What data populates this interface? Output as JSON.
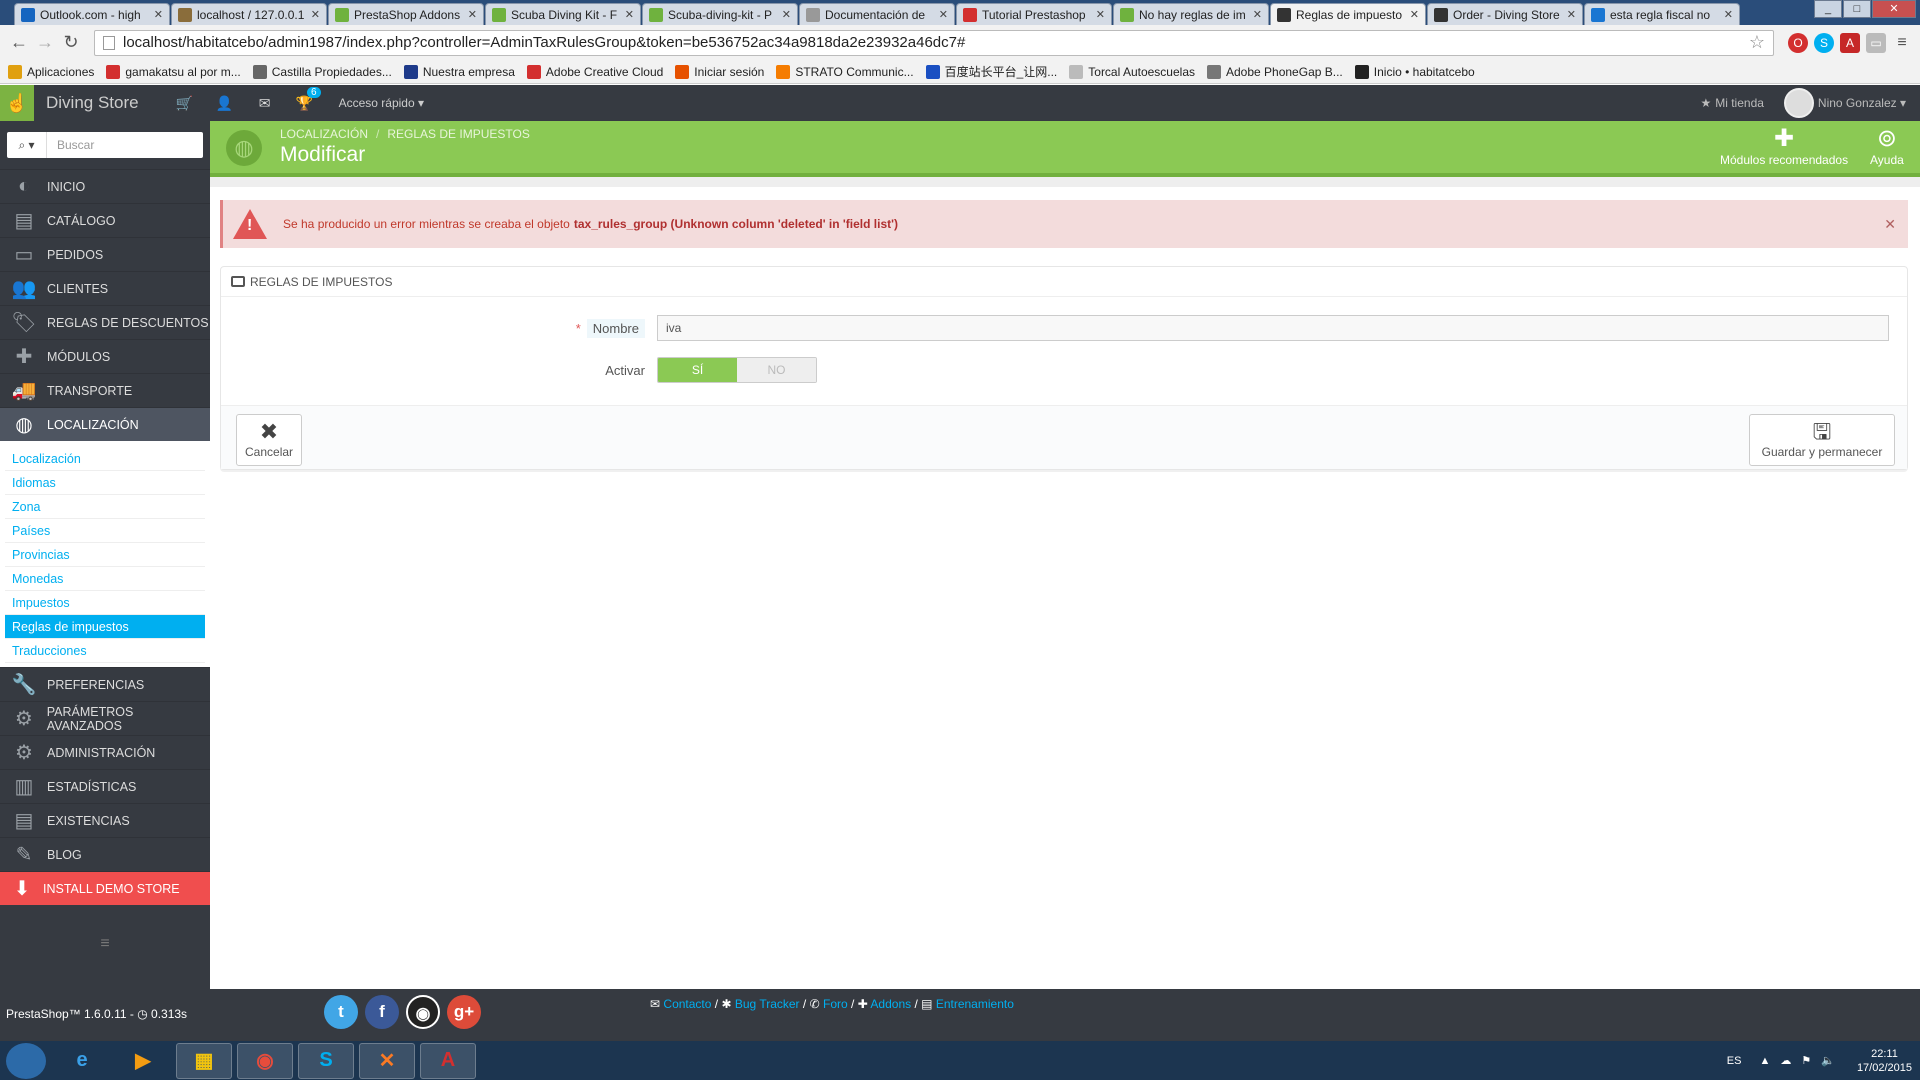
{
  "browser": {
    "tabs": [
      {
        "label": "Outlook.com - high",
        "color": "#1565c0"
      },
      {
        "label": "localhost / 127.0.0.1",
        "color": "#8a6d3b"
      },
      {
        "label": "PrestaShop Addons",
        "color": "#6fb23e"
      },
      {
        "label": "Scuba Diving Kit - F",
        "color": "#6fb23e"
      },
      {
        "label": "Scuba-diving-kit - P",
        "color": "#6fb23e"
      },
      {
        "label": "Documentación de",
        "color": "#999999"
      },
      {
        "label": "Tutorial Prestashop",
        "color": "#d32f2f"
      },
      {
        "label": "No hay reglas de im",
        "color": "#6fb23e"
      },
      {
        "label": "Reglas de impuesto",
        "color": "#333333"
      },
      {
        "label": "Order - Diving Store",
        "color": "#333333"
      },
      {
        "label": "esta regla fiscal no",
        "color": "#1976d2"
      }
    ],
    "active_tab_index": 8,
    "url": "localhost/habitatcebo/admin1987/index.php?controller=AdminTaxRulesGroup&token=be536752ac34a9818da2e23932a46dc7#",
    "bookmarks": [
      {
        "label": "Aplicaciones",
        "color": "#e0a010"
      },
      {
        "label": "gamakatsu al por m...",
        "color": "#d32f2f"
      },
      {
        "label": "Castilla Propiedades...",
        "color": "#666666"
      },
      {
        "label": "Nuestra empresa",
        "color": "#1e3a8a"
      },
      {
        "label": "Adobe Creative Cloud",
        "color": "#d32f2f"
      },
      {
        "label": "Iniciar sesión",
        "color": "#e65100"
      },
      {
        "label": "STRATO Communic...",
        "color": "#f57c00"
      },
      {
        "label": "百度站长平台_让网...",
        "color": "#1a4fc2"
      },
      {
        "label": "Torcal Autoescuelas",
        "color": "#bbbbbb"
      },
      {
        "label": "Adobe PhoneGap B...",
        "color": "#777777"
      },
      {
        "label": "Inicio • habitatcebo",
        "color": "#222222"
      }
    ]
  },
  "header": {
    "store_name": "Diving Store",
    "notifications_count": "6",
    "quick_access": "Acceso rápido",
    "my_shop": "Mi tienda",
    "user_name": "Nino Gonzalez"
  },
  "sidebar": {
    "search_placeholder": "Buscar",
    "items_top": [
      {
        "label": "INICIO"
      },
      {
        "label": "CATÁLOGO"
      },
      {
        "label": "PEDIDOS"
      },
      {
        "label": "CLIENTES"
      },
      {
        "label": "REGLAS DE DESCUENTOS"
      },
      {
        "label": "MÓDULOS"
      },
      {
        "label": "TRANSPORTE"
      }
    ],
    "active_item": "LOCALIZACIÓN",
    "submenu": [
      "Localización",
      "Idiomas",
      "Zona",
      "Países",
      "Provincias",
      "Monedas",
      "Impuestos",
      "Reglas de impuestos",
      "Traducciones"
    ],
    "submenu_selected": "Reglas de impuestos",
    "items_bottom": [
      {
        "label": "PREFERENCIAS"
      },
      {
        "label": "PARÁMETROS AVANZADOS"
      },
      {
        "label": "ADMINISTRACIÓN"
      },
      {
        "label": "ESTADÍSTICAS"
      },
      {
        "label": "EXISTENCIAS"
      },
      {
        "label": "BLOG"
      }
    ],
    "demo_label": "INSTALL DEMO STORE"
  },
  "page": {
    "breadcrumb": [
      "LOCALIZACIÓN",
      "REGLAS DE IMPUESTOS"
    ],
    "title": "Modificar",
    "recommended_modules": "Módulos recomendados",
    "help": "Ayuda"
  },
  "alert": {
    "message": "Se ha producido un error mientras se creaba el objeto",
    "detail": "tax_rules_group (Unknown column 'deleted' in 'field list')"
  },
  "form": {
    "panel_title": "REGLAS DE IMPUESTOS",
    "name_label": "Nombre",
    "name_value": "iva",
    "active_label": "Activar",
    "switch_on": "SÍ",
    "switch_off": "NO",
    "cancel": "Cancelar",
    "save_stay": "Guardar y permanecer"
  },
  "footer": {
    "version": "PrestaShop™ 1.6.0.11 - ",
    "load_time": "0.313s",
    "links": [
      "Contacto",
      "Bug Tracker",
      "Foro",
      "Addons",
      "Entrenamiento"
    ]
  },
  "taskbar": {
    "language": "ES",
    "time": "22:11",
    "date": "17/02/2015"
  },
  "colors": {
    "accent": "#00aff0",
    "header_green": "#8bc954",
    "error": "#e05656",
    "sidebar": "#363a41"
  }
}
